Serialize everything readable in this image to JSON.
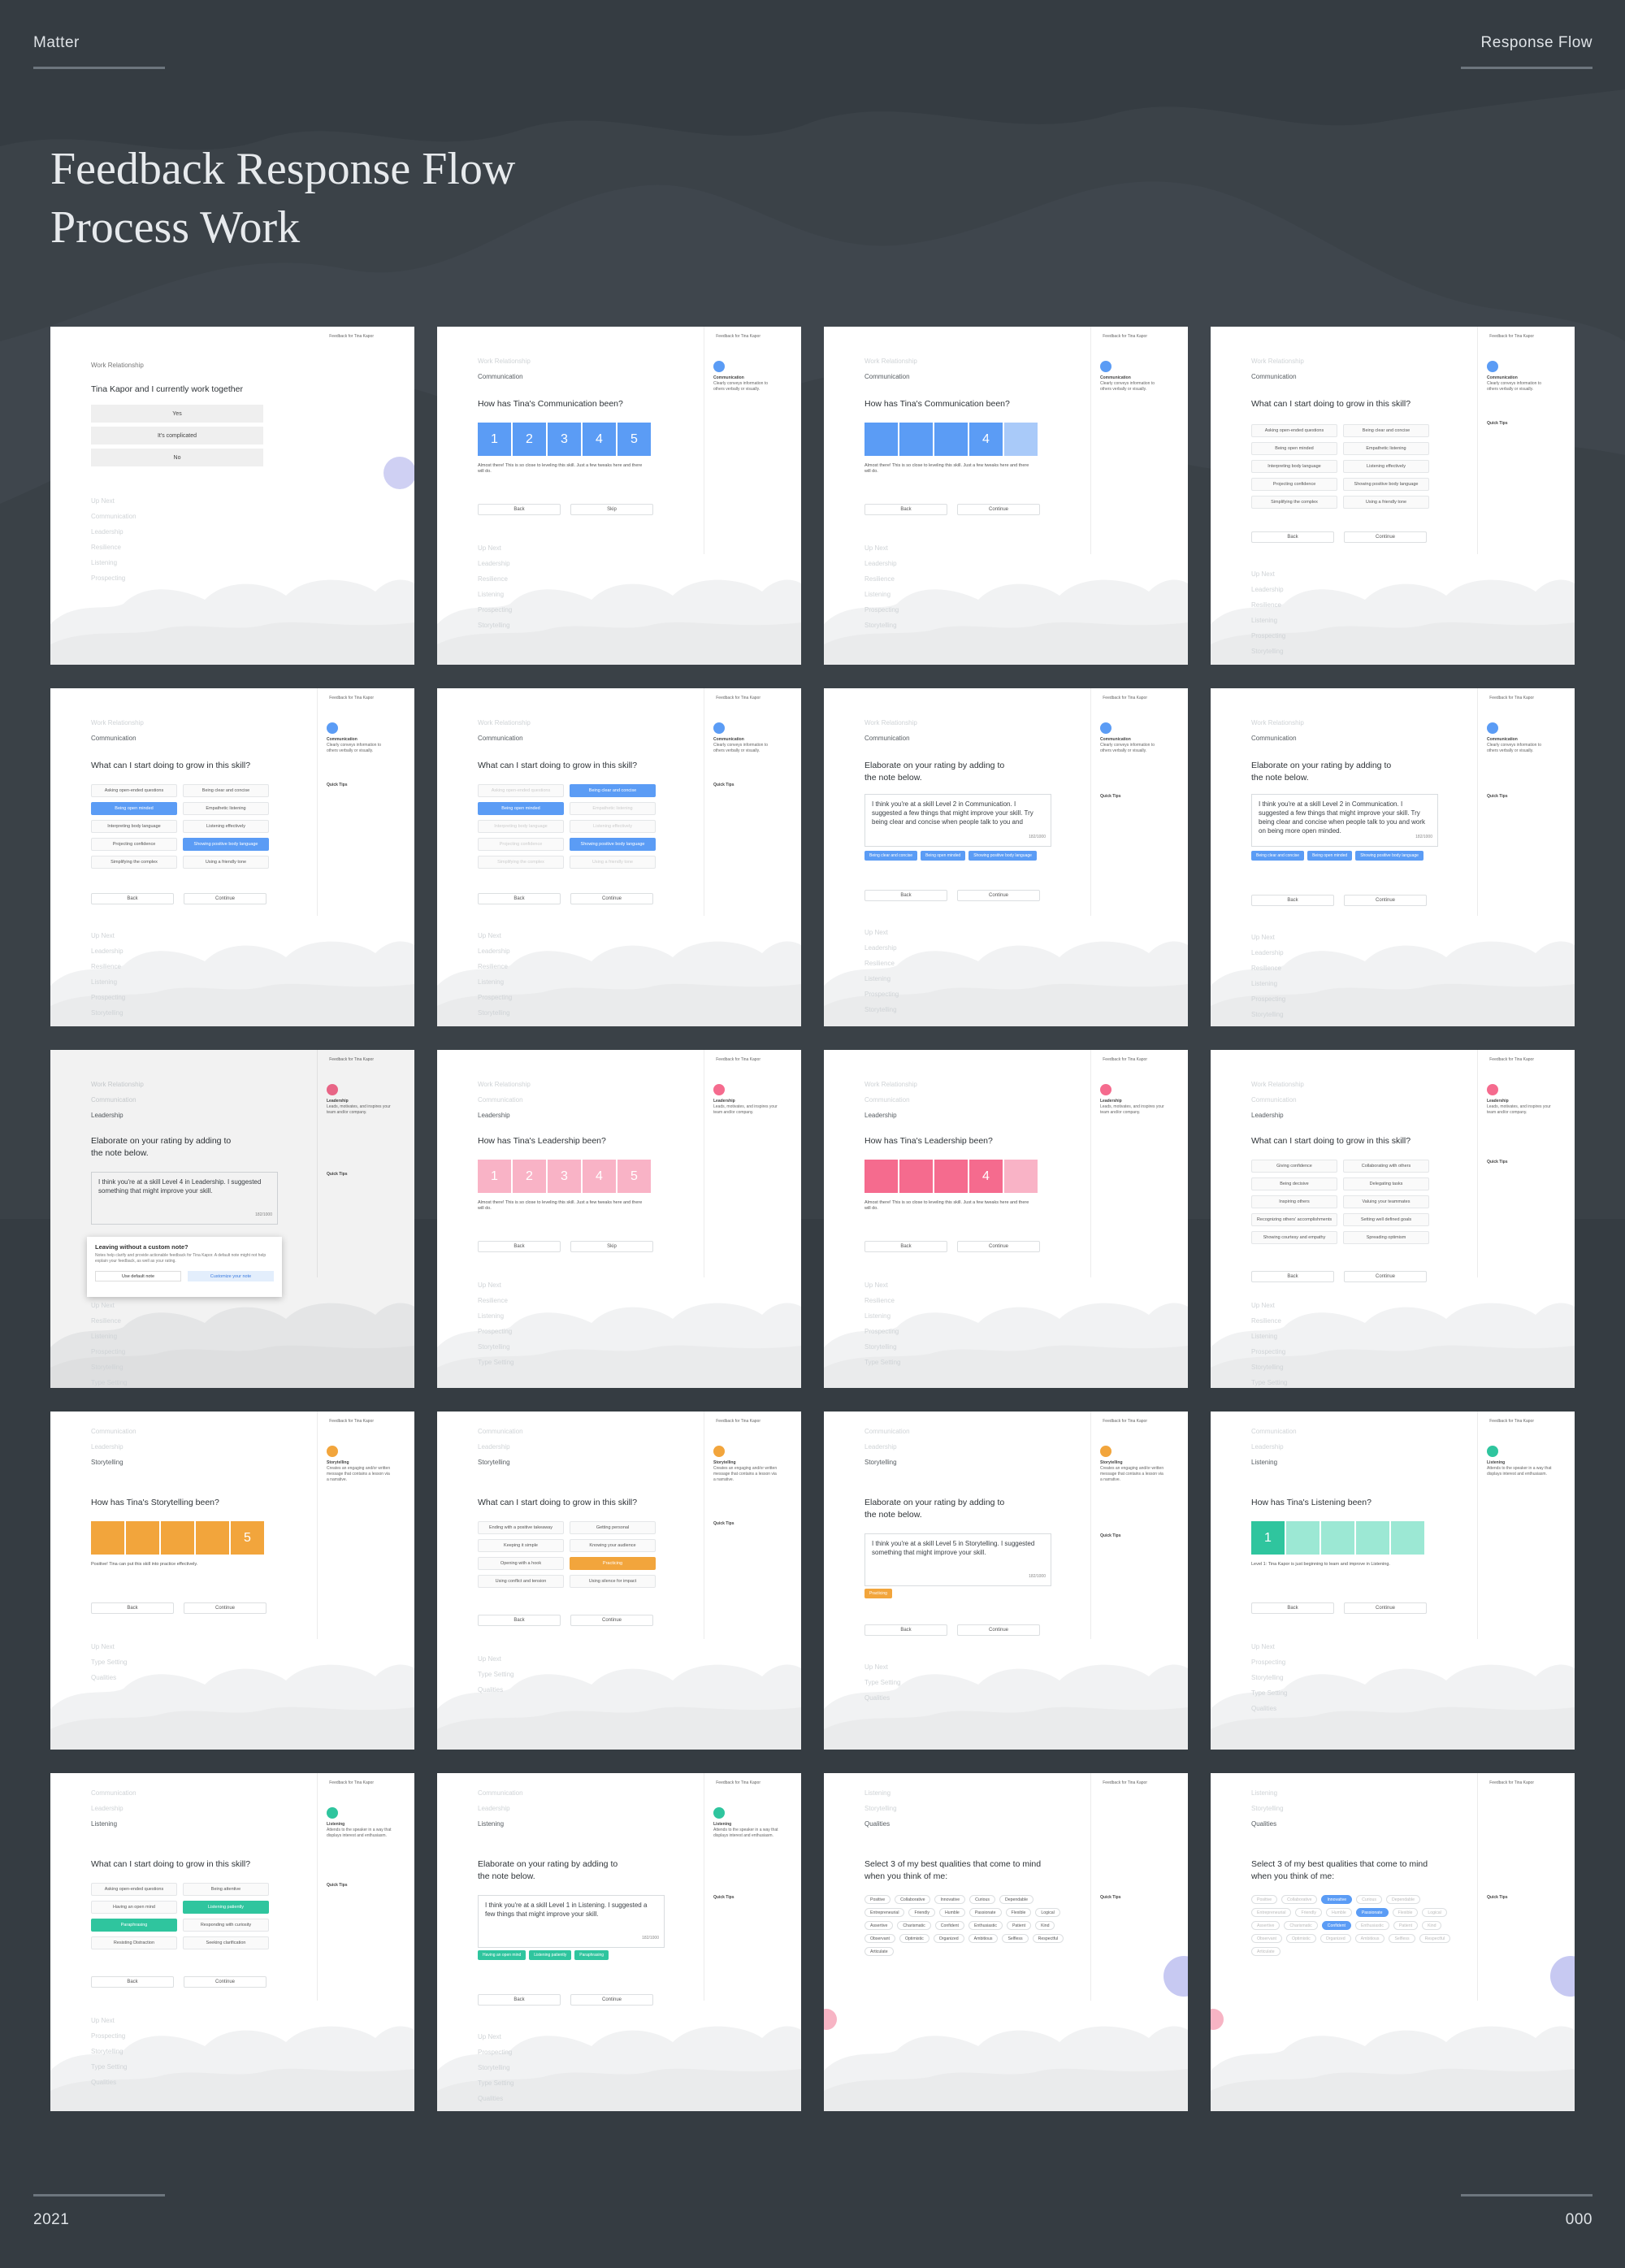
{
  "corners": {
    "top_left": "Matter",
    "top_right": "Response Flow",
    "bottom_left": "2021",
    "bottom_right": "000"
  },
  "hero": {
    "line1": "Feedback Response Flow",
    "line2": "Process Work"
  },
  "colors": {
    "background": "#353c42",
    "blue": "#5b9cf5",
    "blue_light": "#a9caf9",
    "pink": "#f56b8e",
    "pink_light": "#f9b3c6",
    "orange": "#f2a53c",
    "teal": "#2fc59e",
    "teal_light": "#9ce8d4"
  },
  "common": {
    "header": "Feedback for Tina Kapor",
    "back": "Back",
    "skip": "Skip",
    "continue": "Continue",
    "up_next": "Up Next",
    "quick_tips": "Quick Tips",
    "count": "182/1000"
  },
  "prog": {
    "wr": "Work Relationship",
    "comm": "Communication",
    "lead": "Leadership",
    "resil": "Resilience",
    "listen": "Listening",
    "prospect": "Prospecting",
    "story": "Storytelling",
    "goal": "Type Setting",
    "qual": "Qualities"
  },
  "skills": {
    "comm_desc": "Clearly conveys information to others verbally or visually.",
    "lead_desc": "Leads, motivates, and inspires your team and/or company.",
    "story_desc": "Creates an engaging and/or written message that contains a lesson via a narrative.",
    "listen_desc": "Attends to the speaker in a way that displays interest and enthusiasm."
  },
  "q": {
    "work_together": "Tina Kapor and I currently work together",
    "comm_rate": "How has Tina's Communication been?",
    "grow": "What can I start doing to grow in this skill?",
    "elaborate": "Elaborate on your rating by adding to the note below.",
    "lead_rate": "How has Tina's Leadership been?",
    "story_rate": "How has Tina's Storytelling been?",
    "listen_rate": "How has Tina's Listening been?",
    "qualities": "Select 3 of my best qualities that come to mind when you think of me:"
  },
  "work_opts": [
    "Yes",
    "It's complicated",
    "No"
  ],
  "scale": [
    "1",
    "2",
    "3",
    "4",
    "5"
  ],
  "comm_chips": [
    "Asking open-ended questions",
    "Being clear and concise",
    "Being open minded",
    "Empathetic listening",
    "Interpreting body language",
    "Listening effectively",
    "Projecting confidence",
    "Showing positive body language",
    "Simplifying the complex",
    "Using a friendly tone"
  ],
  "lead_chips": [
    "Giving confidence",
    "Collaborating with others",
    "Being decisive",
    "Delegating tasks",
    "Inspiring others",
    "Valuing your teammates",
    "Recognizing others' accomplishments",
    "Setting well defined goals",
    "Showing courtesy and empathy",
    "Spreading optimism"
  ],
  "story_chips": [
    "Ending with a positive takeaway",
    "Getting personal",
    "Keeping it simple",
    "Knowing your audience",
    "Opening with a hook",
    "Practicing",
    "Using conflict and tension",
    "Using silence for impact"
  ],
  "listen_chips": [
    "Asking open-ended questions",
    "Being attentive",
    "Having an open mind",
    "Listening patiently",
    "Paraphrasing",
    "Responding with curiosity",
    "Resisting Distraction",
    "Seeking clarification"
  ],
  "notes": {
    "comm": "I think you're at a skill Level 2 in Communication. I suggested a few things that might improve your skill. Try being clear and concise when people talk to you and",
    "comm2": "I think you're at a skill Level 2 in Communication. I suggested a few things that might improve your skill. Try being clear and concise when people talk to you and work on being more open minded.",
    "lead": "I think you're at a skill Level 4 in Leadership. I suggested something that might improve your skill.",
    "story": "I think you're at a skill Level 5 in Storytelling. I suggested something that might improve your skill.",
    "listen": "I think you're at a skill Level 1 in Listening. I suggested a few things that might improve your skill."
  },
  "comm_tags": [
    "Being clear and concise",
    "Being open minded",
    "Showing positive body language"
  ],
  "story_tag": "Practicing",
  "listen_tags": [
    "Having an open mind",
    "Listening patiently",
    "Paraphrasing"
  ],
  "modal": {
    "title": "Leaving without a custom note?",
    "body": "Notes help clarify and provide actionable feedback for Tina Kapor. A default note might not help explain your feedback, as well as your rating.",
    "default_btn": "Use default note",
    "custom_btn": "Customize your note"
  },
  "almost_there": "Almost there! This is so close to leveling this skill. Just a few tweaks here and there will do.",
  "pos_story": "Positive! Tina can put this skill into practice effectively.",
  "level1": "Level 1: Tina Kapor is just beginning to learn and improve in Listening.",
  "qualities": [
    "Positive",
    "Collaborative",
    "Innovative",
    "Curious",
    "Dependable",
    "Entrepreneurial",
    "Friendly",
    "Humble",
    "Passionate",
    "Flexible",
    "Logical",
    "Assertive",
    "Charismatic",
    "Confident",
    "Enthusiastic",
    "Patient",
    "Kind",
    "Observant",
    "Optimistic",
    "Organized",
    "Ambitious",
    "Selfless",
    "Respectful",
    "Articulate"
  ],
  "selected_qualities": [
    "Innovative",
    "Passionate",
    "Confident"
  ]
}
